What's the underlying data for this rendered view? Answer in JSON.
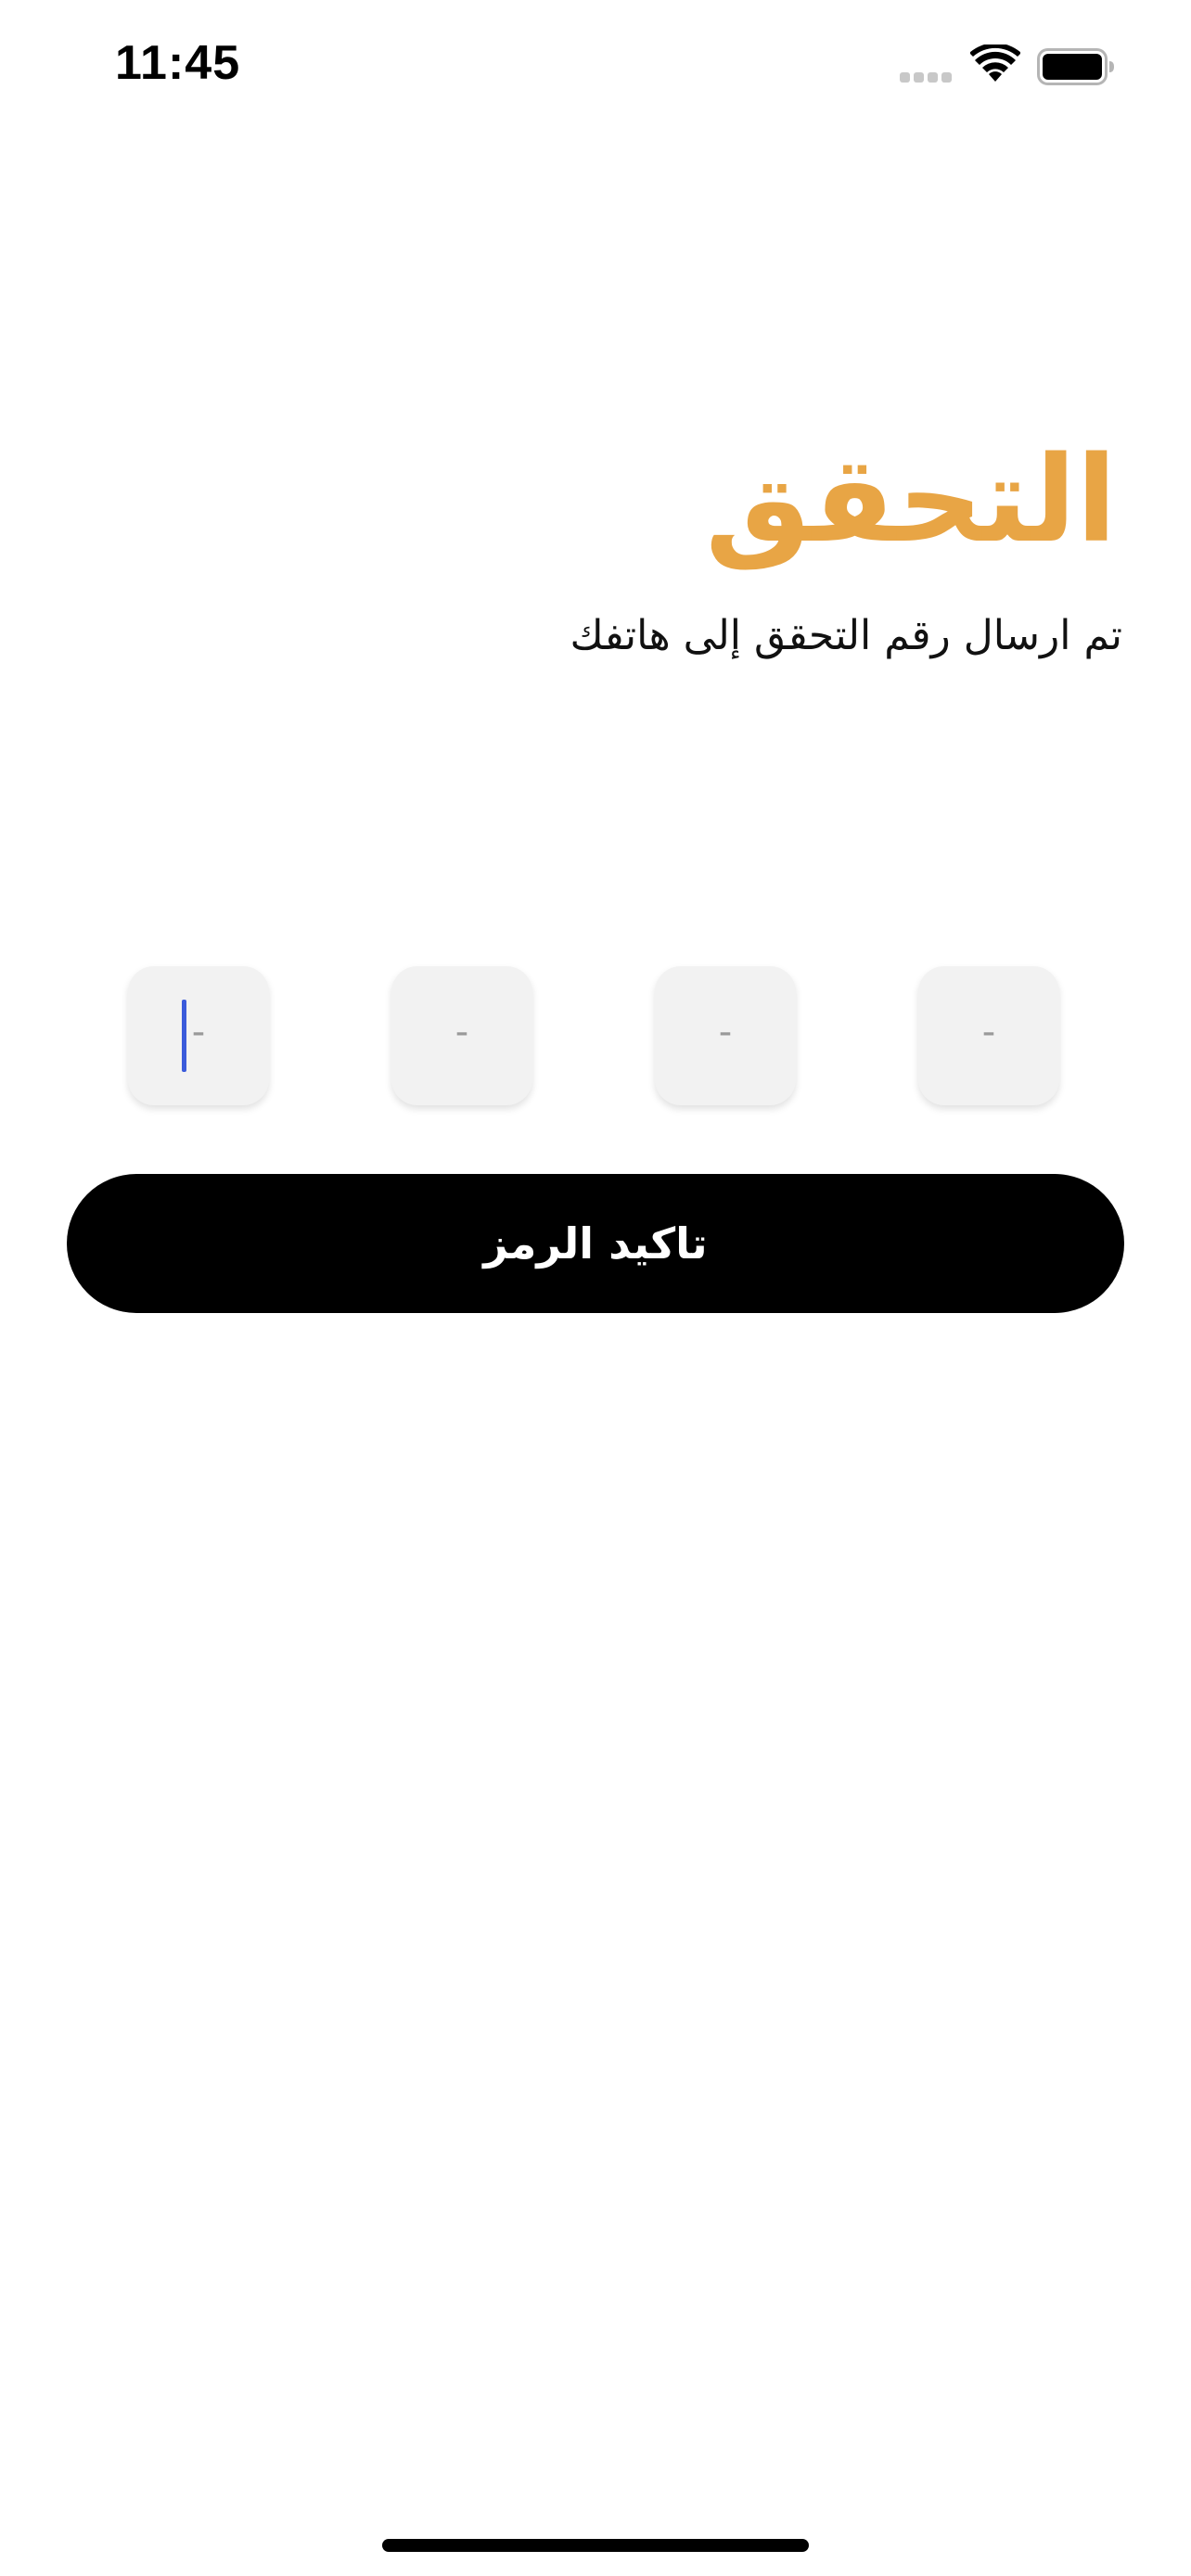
{
  "status_bar": {
    "time": "11:45"
  },
  "verification": {
    "title": "التحقق",
    "subtitle": "تم ارسال رقم التحقق إلى هاتفك"
  },
  "otp": {
    "digits": [
      {
        "value": "",
        "placeholder": "-"
      },
      {
        "value": "",
        "placeholder": "-"
      },
      {
        "value": "",
        "placeholder": "-"
      },
      {
        "value": "",
        "placeholder": "-"
      }
    ],
    "focused_index": 0
  },
  "actions": {
    "confirm_label": "تاكيد الرمز"
  },
  "colors": {
    "accent": "#E8A545",
    "button": "#000000",
    "caret": "#3b5bdb",
    "field_bg": "#f2f2f2"
  }
}
